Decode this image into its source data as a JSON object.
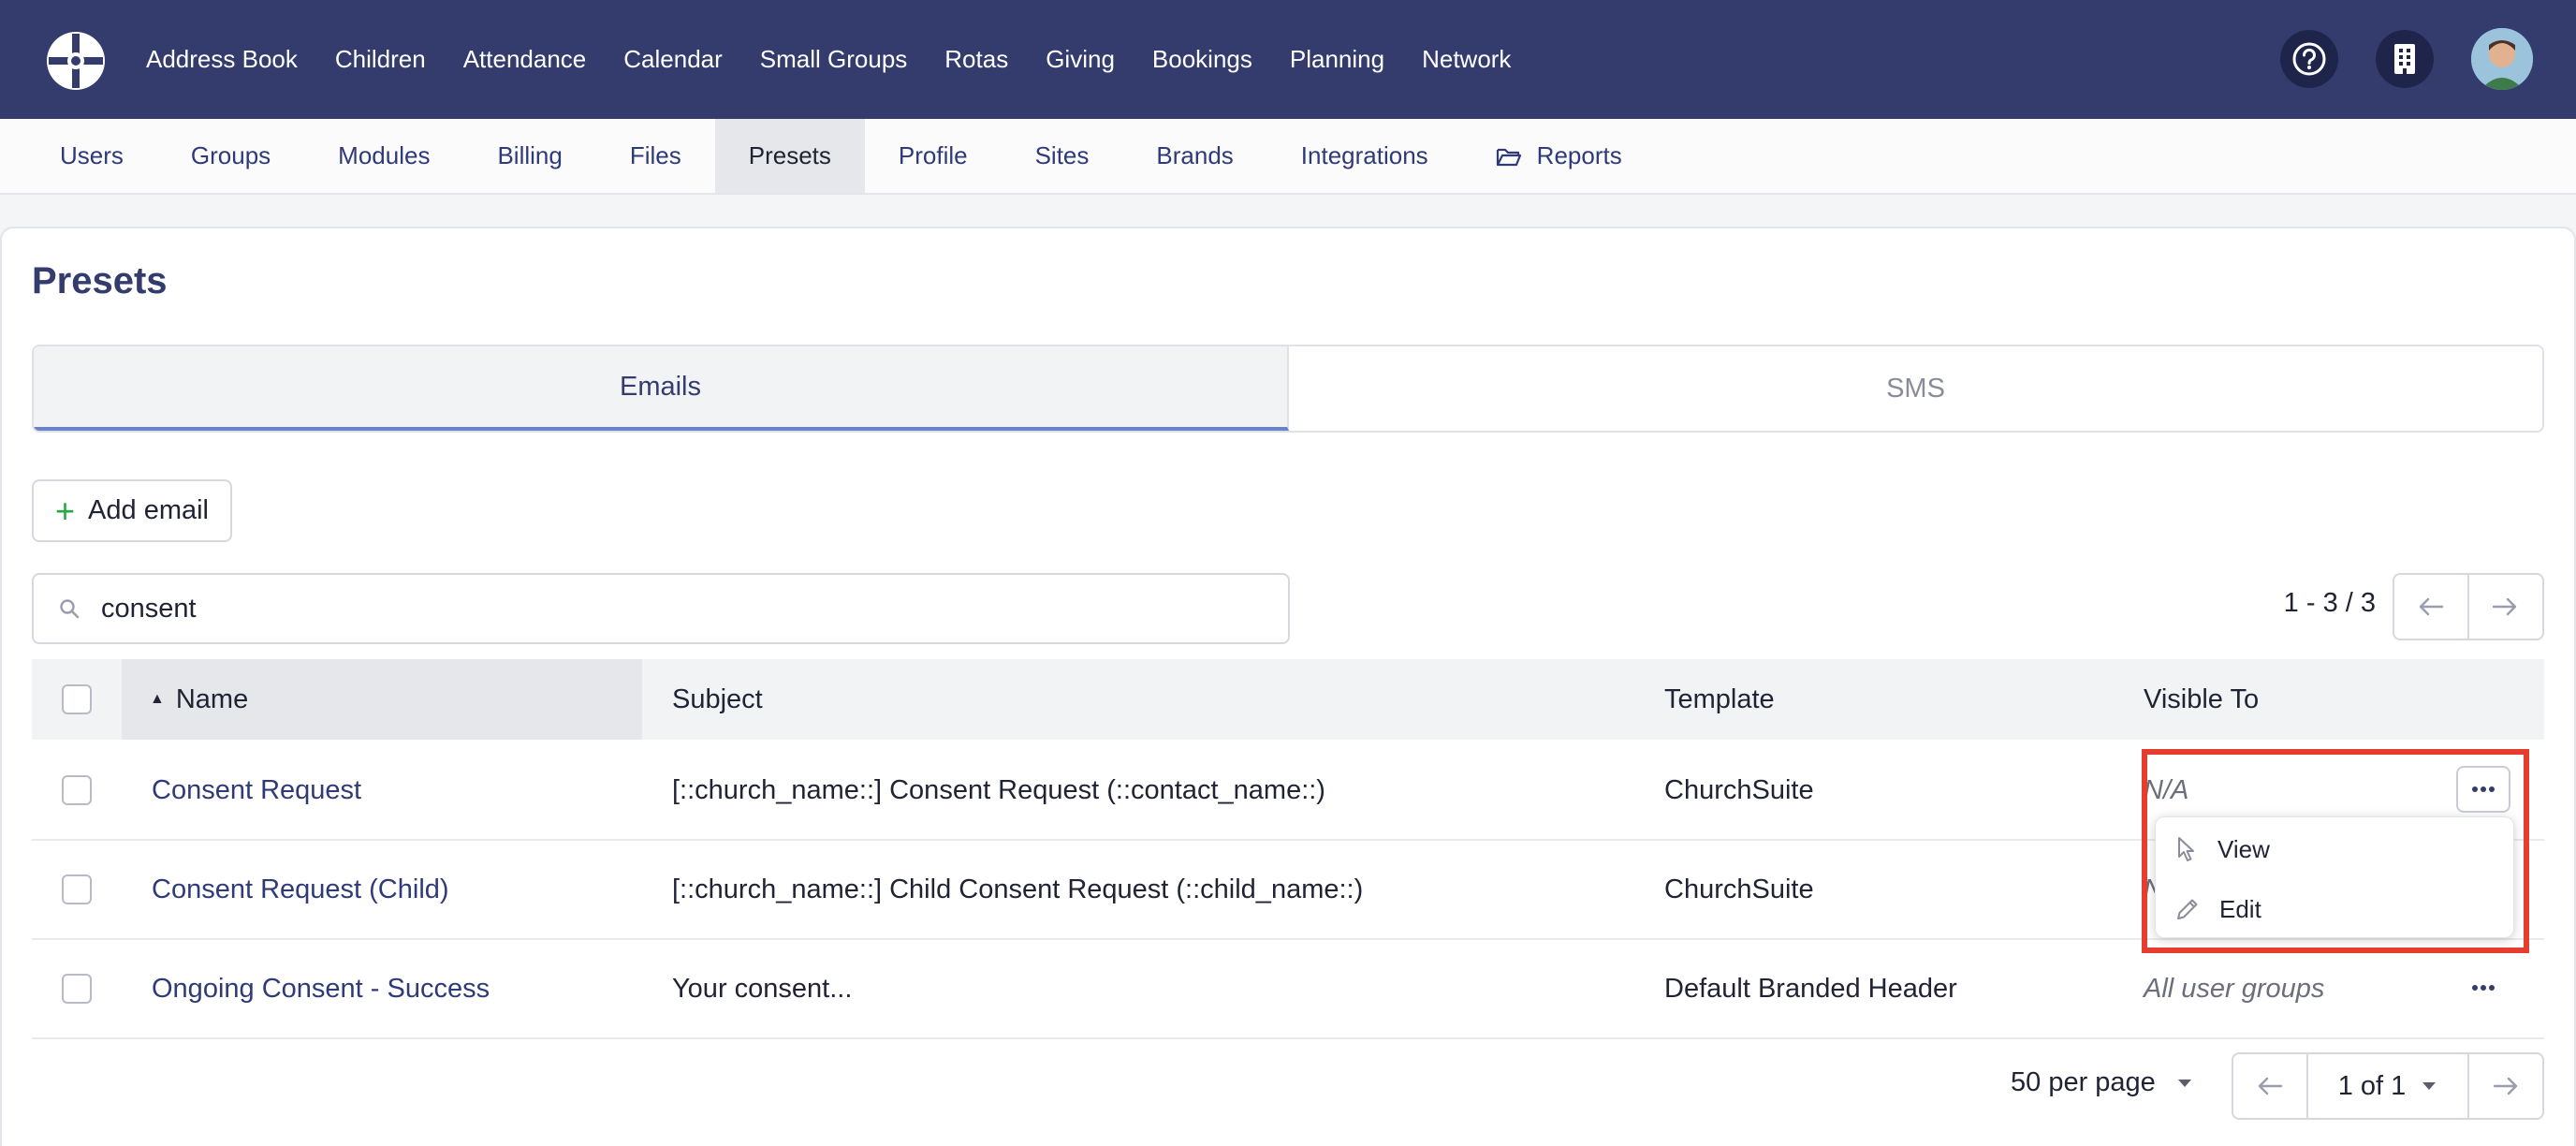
{
  "nav": {
    "items": [
      "Address Book",
      "Children",
      "Attendance",
      "Calendar",
      "Small Groups",
      "Rotas",
      "Giving",
      "Bookings",
      "Planning",
      "Network"
    ]
  },
  "subnav": {
    "items": [
      "Users",
      "Groups",
      "Modules",
      "Billing",
      "Files",
      "Presets",
      "Profile",
      "Sites",
      "Brands",
      "Integrations",
      "Reports"
    ],
    "active": "Presets"
  },
  "page": {
    "title": "Presets",
    "tabs": [
      "Emails",
      "SMS"
    ],
    "active_tab": "Emails",
    "add_label": "Add email"
  },
  "search": {
    "value": "consent",
    "placeholder": ""
  },
  "pagination": {
    "range": "1 - 3 / 3",
    "per_page": "50 per page",
    "page": "1 of 1"
  },
  "table": {
    "columns": [
      "Name",
      "Subject",
      "Template",
      "Visible To"
    ],
    "sort_column": "Name",
    "rows": [
      {
        "name": "Consent Request",
        "subject": "[::church_name::] Consent Request (::contact_name::)",
        "template": "ChurchSuite",
        "visible": "N/A"
      },
      {
        "name": "Consent Request (Child)",
        "subject": "[::church_name::] Child Consent Request (::child_name::)",
        "template": "ChurchSuite",
        "visible": "N/A"
      },
      {
        "name": "Ongoing Consent - Success",
        "subject": "Your consent...",
        "template": "Default Branded Header",
        "visible": "All user groups"
      }
    ]
  },
  "row_menu": {
    "items": [
      "View",
      "Edit"
    ]
  },
  "colors": {
    "nav_bg": "#333c6d",
    "link": "#2f3a78",
    "accent_green": "#27a844",
    "highlight": "#e53e2e"
  }
}
